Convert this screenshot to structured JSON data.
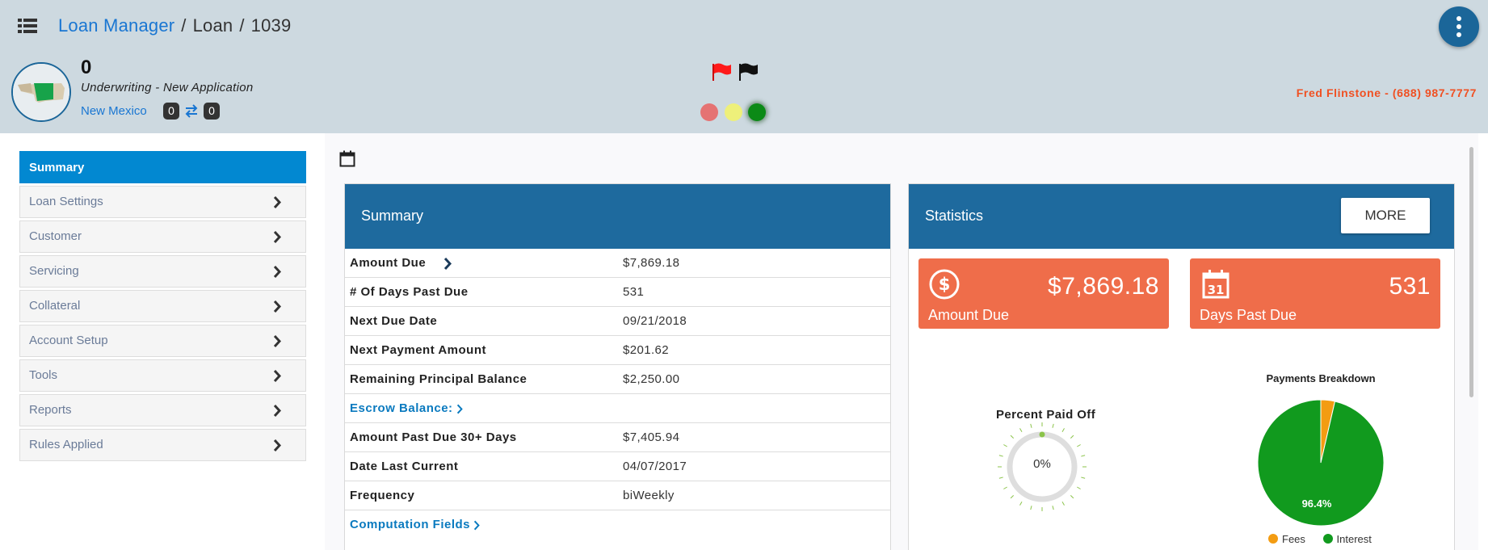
{
  "header": {
    "breadcrumb": [
      {
        "label": "Loan Manager"
      },
      {
        "label": "Loan"
      },
      {
        "label": "1039"
      }
    ],
    "separator": "/",
    "loan": {
      "number": "0",
      "status": "Underwriting - New Application",
      "state": "New Mexico",
      "counter_left": "0",
      "counter_right": "0"
    },
    "flags": [
      "red-flag-icon",
      "black-flag-icon"
    ],
    "status_dots": [
      {
        "name": "red",
        "color": "#e57373"
      },
      {
        "name": "yellow",
        "color": "#eef07a"
      },
      {
        "name": "green",
        "color": "#0b8a16"
      }
    ],
    "contact": "Fred Flinstone - (688) 987-7777"
  },
  "sidebar": {
    "items": [
      {
        "label": "Summary",
        "active": true
      },
      {
        "label": "Loan Settings"
      },
      {
        "label": "Customer"
      },
      {
        "label": "Servicing"
      },
      {
        "label": "Collateral"
      },
      {
        "label": "Account Setup"
      },
      {
        "label": "Tools"
      },
      {
        "label": "Reports"
      },
      {
        "label": "Rules Applied"
      }
    ]
  },
  "summary": {
    "title": "Summary",
    "rows": [
      {
        "label": "Amount Due",
        "value": "$7,869.18"
      },
      {
        "label": "# Of Days Past Due",
        "value": "531"
      },
      {
        "label": "Next Due Date",
        "value": "09/21/2018"
      },
      {
        "label": "Next Payment Amount",
        "value": "$201.62"
      },
      {
        "label": "Remaining Principal Balance",
        "value": "$2,250.00"
      },
      {
        "label": "Escrow Balance:",
        "value": ""
      },
      {
        "label": "Amount Past Due 30+ Days",
        "value": "$7,405.94"
      },
      {
        "label": "Date Last Current",
        "value": "04/07/2017"
      },
      {
        "label": "Frequency",
        "value": "biWeekly"
      },
      {
        "label": "Computation Fields",
        "value": ""
      }
    ]
  },
  "statistics": {
    "title": "Statistics",
    "more_label": "MORE",
    "cards": [
      {
        "value": "$7,869.18",
        "label": "Amount Due",
        "icon": "dollar-circle-icon"
      },
      {
        "value": "531",
        "label": "Days Past Due",
        "icon": "calendar-31-icon"
      }
    ],
    "percent_paid_off": {
      "title": "Percent Paid Off",
      "value": "0%",
      "fraction": 0
    },
    "payments_breakdown": {
      "title": "Payments Breakdown",
      "slices": [
        {
          "name": "Fees",
          "percent": 3.6,
          "color": "#f39c12"
        },
        {
          "name": "Interest",
          "percent": 96.4,
          "color": "#119a1e"
        }
      ],
      "label": "96.4%"
    }
  },
  "colors": {
    "header_bg": "#cdd9e0",
    "accent": "#1e6a9e",
    "active_nav": "#0288d1",
    "card": "#ef6d4a",
    "contact": "#f05022"
  }
}
